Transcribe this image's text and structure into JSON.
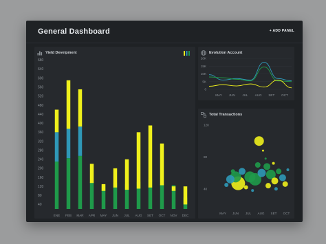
{
  "header": {
    "title": "General Dashboard",
    "add_panel": "+ ADD PANEL"
  },
  "panels": {
    "yield": {
      "title": "Yield Develpment"
    },
    "evolution": {
      "title": "Evolution Account"
    },
    "transactions": {
      "title": "Total Transactions"
    }
  },
  "icons": {
    "yield": "bar-chart-icon",
    "evolution": "globe-icon",
    "transactions": "network-icon",
    "legend": "legend-bars-icon"
  },
  "colors": {
    "green": "#1f9a4a",
    "blue": "#2f98b7",
    "yellow": "#eff01c",
    "background": "#1f2225",
    "panel": "#26292d"
  },
  "chart_data": [
    {
      "type": "bar",
      "title": "Yield Develpment",
      "stacked": true,
      "categories": [
        "ENE",
        "FEB",
        "MAR",
        "APR",
        "MAY",
        "JUN",
        "JUL",
        "AUG",
        "SET",
        "OCT",
        "NOV",
        "DEC"
      ],
      "yticks": [
        40,
        80,
        120,
        160,
        200,
        240,
        280,
        320,
        360,
        400,
        440,
        480,
        520,
        560,
        600,
        640,
        680
      ],
      "ylim": [
        20,
        690
      ],
      "series": [
        {
          "color": "#1f9a4a",
          "values": [
            230,
            245,
            255,
            140,
            125,
            135,
            130,
            140,
            150,
            130,
            125,
            70
          ]
        },
        {
          "color": "#2f98b7",
          "values": [
            360,
            375,
            385,
            135,
            100,
            115,
            105,
            110,
            115,
            125,
            100,
            40
          ]
        },
        {
          "color": "#eff01c",
          "values": [
            460,
            590,
            550,
            220,
            130,
            200,
            240,
            360,
            390,
            310,
            120,
            120
          ]
        }
      ]
    },
    {
      "type": "line",
      "title": "Evolution Account",
      "categories": [
        "MAY",
        "JUN",
        "JUL",
        "AUG",
        "SET",
        "OCT"
      ],
      "yticks": [
        "0",
        "5K",
        "10K",
        "15K",
        "20K"
      ],
      "ylim": [
        0,
        20000
      ],
      "series": [
        {
          "color": "#2f98b7",
          "values": [
            9500,
            6000,
            7000,
            6000,
            17500,
            7000,
            5500
          ]
        },
        {
          "color": "#1f9a4a",
          "values": [
            8000,
            7500,
            6500,
            5500,
            14500,
            5500,
            5000
          ]
        },
        {
          "color": "#eff01c",
          "values": [
            2000,
            3000,
            2200,
            3500,
            1500,
            6000,
            1000
          ]
        }
      ]
    },
    {
      "type": "scatter",
      "title": "Total Transactions",
      "categories": [
        "MAY",
        "JUN",
        "JUL",
        "AUG",
        "SET",
        "OCT"
      ],
      "yticks": [
        40,
        80,
        120
      ],
      "ylim": [
        20,
        120
      ],
      "points": [
        {
          "x": 3.3,
          "y": 100,
          "r": 7,
          "color": "#eff01c"
        },
        {
          "x": 1.7,
          "y": 47,
          "r": 10,
          "color": "#eff01c"
        },
        {
          "x": 1.5,
          "y": 55,
          "r": 8,
          "color": "#1f9a4a"
        },
        {
          "x": 1.1,
          "y": 52,
          "r": 6,
          "color": "#2f98b7"
        },
        {
          "x": 2.0,
          "y": 62,
          "r": 5,
          "color": "#2f98b7"
        },
        {
          "x": 2.6,
          "y": 55,
          "r": 8,
          "color": "#1f9a4a"
        },
        {
          "x": 3.0,
          "y": 52,
          "r": 9,
          "color": "#1f9a4a"
        },
        {
          "x": 3.5,
          "y": 60,
          "r": 6,
          "color": "#2f98b7"
        },
        {
          "x": 3.2,
          "y": 70,
          "r": 4,
          "color": "#1f9a4a"
        },
        {
          "x": 3.9,
          "y": 68,
          "r": 5,
          "color": "#1f9a4a"
        },
        {
          "x": 4.2,
          "y": 58,
          "r": 7,
          "color": "#1f9a4a"
        },
        {
          "x": 4.5,
          "y": 50,
          "r": 5,
          "color": "#eff01c"
        },
        {
          "x": 4.8,
          "y": 62,
          "r": 4,
          "color": "#1f9a4a"
        },
        {
          "x": 5.1,
          "y": 54,
          "r": 5,
          "color": "#2f98b7"
        },
        {
          "x": 5.3,
          "y": 46,
          "r": 4,
          "color": "#eff01c"
        },
        {
          "x": 4.0,
          "y": 44,
          "r": 4,
          "color": "#eff01c"
        },
        {
          "x": 2.3,
          "y": 42,
          "r": 3,
          "color": "#eff01c"
        },
        {
          "x": 0.8,
          "y": 45,
          "r": 3,
          "color": "#2f98b7"
        },
        {
          "x": 1.3,
          "y": 62,
          "r": 3,
          "color": "#1f9a4a"
        },
        {
          "x": 3.6,
          "y": 88,
          "r": 1.5,
          "color": "#eff01c"
        },
        {
          "x": 3.8,
          "y": 78,
          "r": 1.5,
          "color": "#1f9a4a"
        },
        {
          "x": 4.4,
          "y": 72,
          "r": 2,
          "color": "#eff01c"
        },
        {
          "x": 5.5,
          "y": 64,
          "r": 2,
          "color": "#2f98b7"
        },
        {
          "x": 2.8,
          "y": 38,
          "r": 2,
          "color": "#2f98b7"
        },
        {
          "x": 4.6,
          "y": 40,
          "r": 2.5,
          "color": "#2f98b7"
        }
      ]
    }
  ]
}
